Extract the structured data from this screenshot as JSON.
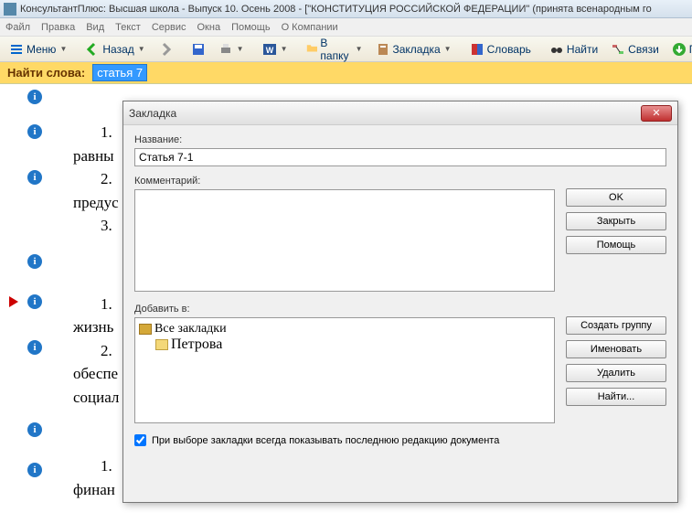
{
  "window": {
    "title": "КонсультантПлюс: Высшая школа - Выпуск 10. Осень 2008 - [\"КОНСТИТУЦИЯ РОССИЙСКОЙ ФЕДЕРАЦИИ\" (принята всенародным го"
  },
  "menubar": [
    "Файл",
    "Правка",
    "Вид",
    "Текст",
    "Сервис",
    "Окна",
    "Помощь",
    "О Компании"
  ],
  "toolbar": {
    "menu": "Меню",
    "back": "Назад",
    "folder": "В папку",
    "bookmark": "Закладка",
    "dictionary": "Словарь",
    "find": "Найти",
    "links": "Связи",
    "po": "По"
  },
  "findbar": {
    "label": "Найти слова:",
    "value": "статья 7"
  },
  "content": {
    "l1": "1.",
    "l1b": "равны",
    "l2": "2.",
    "l2b": "предус",
    "l3": "3.",
    "l4": "1.",
    "l4b": "жизнь",
    "l5": "2.",
    "l5b": "обеспе",
    "l5c": "социал",
    "l6": "1.",
    "l6b": "финан"
  },
  "dialog": {
    "title": "Закладка",
    "name_label": "Название:",
    "name_value": "Статья 7-1",
    "comment_label": "Комментарий:",
    "comment_value": "",
    "addto_label": "Добавить в:",
    "tree": {
      "root": "Все закладки",
      "child": "Петрова"
    },
    "buttons": {
      "ok": "OK",
      "close": "Закрыть",
      "help": "Помощь",
      "create_group": "Создать группу",
      "rename": "Именовать",
      "delete": "Удалить",
      "find": "Найти..."
    },
    "checkbox_label": "При выборе закладки всегда показывать последнюю редакцию документа",
    "checkbox_checked": true
  }
}
